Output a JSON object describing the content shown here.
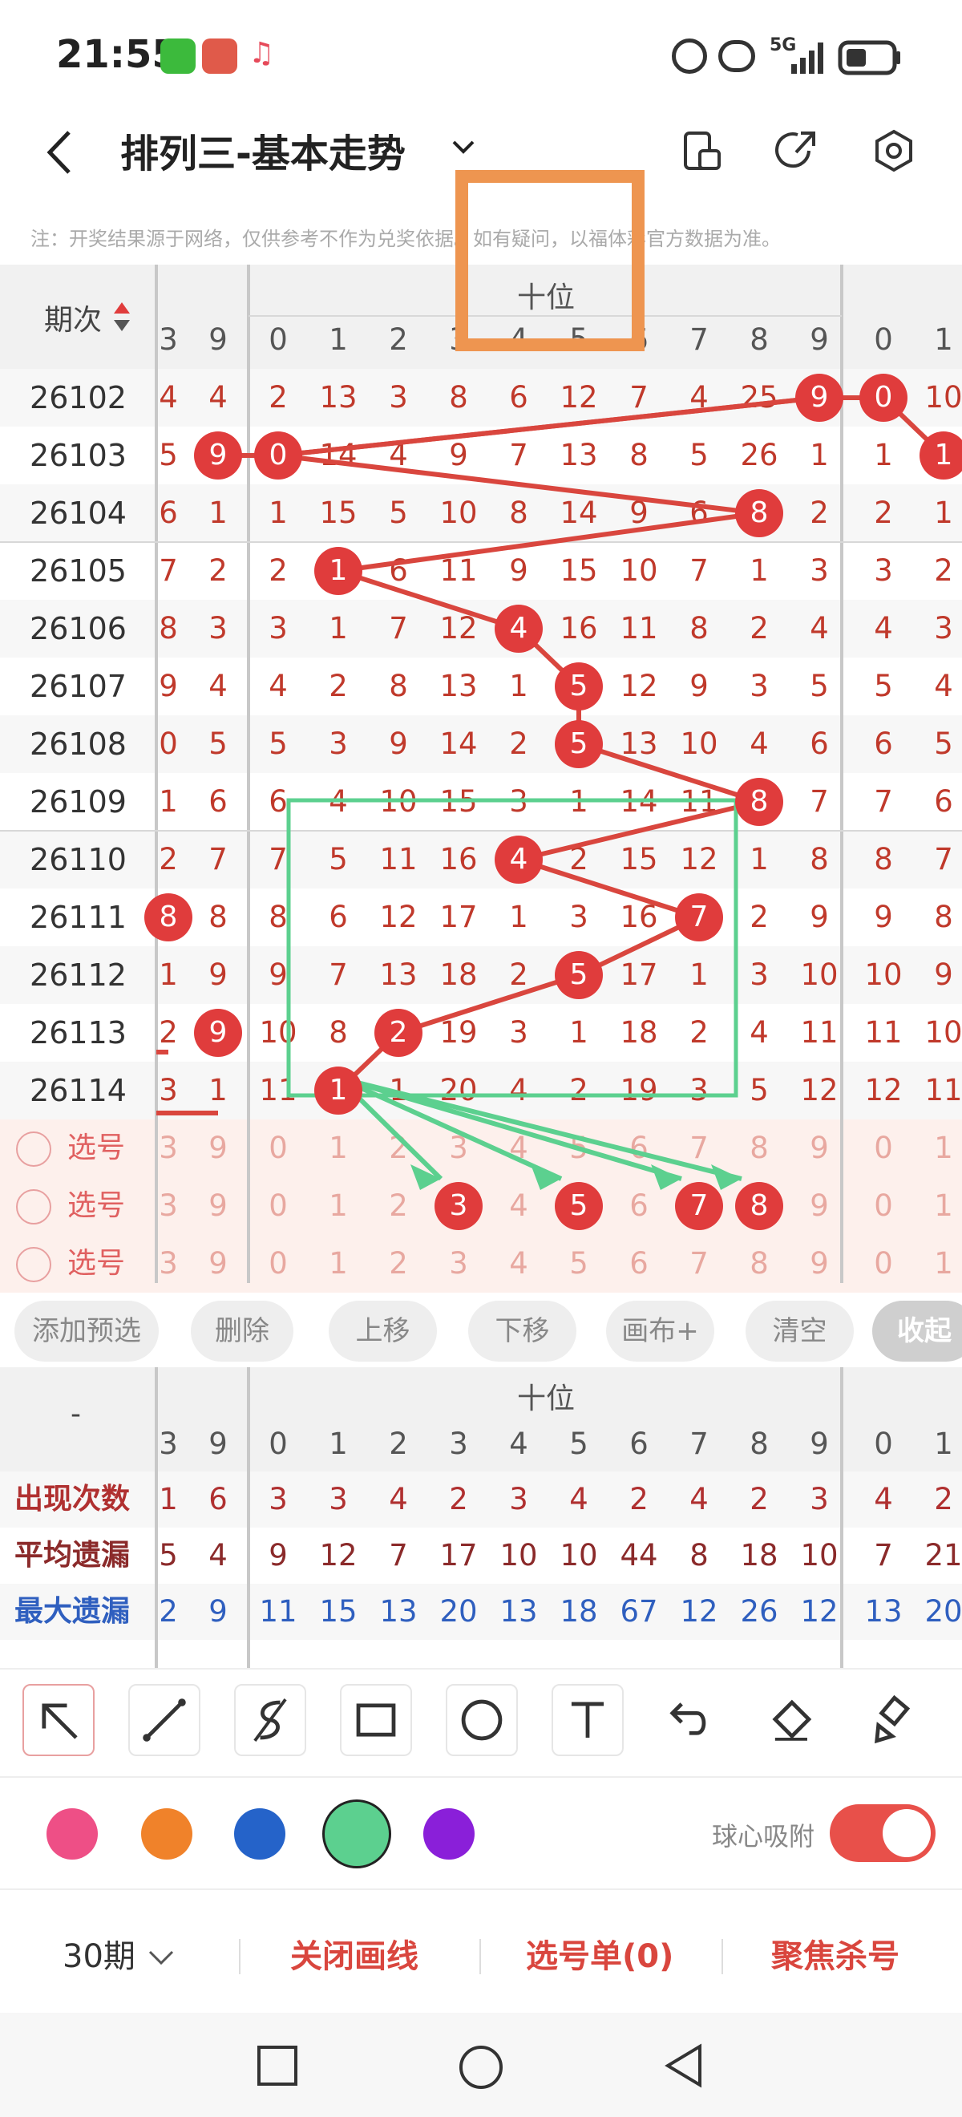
{
  "status": {
    "time": "21:55",
    "signal_label": "5G"
  },
  "header": {
    "title": "排列三-基本走势",
    "note": "注：开奖结果源于网络，仅供参考不作为兑奖依据。如有疑问，以福体彩官方数据为准。"
  },
  "table": {
    "period_header": "期次",
    "group_header": "十位",
    "column_digits": [
      "3",
      "9",
      "0",
      "1",
      "2",
      "3",
      "4",
      "5",
      "6",
      "7",
      "8",
      "9",
      "0",
      "1"
    ],
    "rows": [
      {
        "period": "26102",
        "cells": [
          "4",
          "4",
          "2",
          "13",
          "3",
          "8",
          "6",
          "12",
          "7",
          "4",
          "25",
          "9",
          "0",
          "10"
        ],
        "balls": [
          11,
          12
        ]
      },
      {
        "period": "26103",
        "cells": [
          "5",
          "9",
          "0",
          "14",
          "4",
          "9",
          "7",
          "13",
          "8",
          "5",
          "26",
          "1",
          "1",
          "1"
        ],
        "balls": [
          1,
          2,
          13
        ]
      },
      {
        "period": "26104",
        "cells": [
          "6",
          "1",
          "1",
          "15",
          "5",
          "10",
          "8",
          "14",
          "9",
          "6",
          "8",
          "2",
          "2",
          "1"
        ],
        "balls": [
          10
        ]
      },
      {
        "period": "26105",
        "cells": [
          "7",
          "2",
          "2",
          "1",
          "6",
          "11",
          "9",
          "15",
          "10",
          "7",
          "1",
          "3",
          "3",
          "2"
        ],
        "balls": [
          3
        ]
      },
      {
        "period": "26106",
        "cells": [
          "8",
          "3",
          "3",
          "1",
          "7",
          "12",
          "4",
          "16",
          "11",
          "8",
          "2",
          "4",
          "4",
          "3"
        ],
        "balls": [
          6
        ]
      },
      {
        "period": "26107",
        "cells": [
          "9",
          "4",
          "4",
          "2",
          "8",
          "13",
          "1",
          "5",
          "12",
          "9",
          "3",
          "5",
          "5",
          "4"
        ],
        "balls": [
          7
        ]
      },
      {
        "period": "26108",
        "cells": [
          "0",
          "5",
          "5",
          "3",
          "9",
          "14",
          "2",
          "5",
          "13",
          "10",
          "4",
          "6",
          "6",
          "5"
        ],
        "balls": [
          7
        ]
      },
      {
        "period": "26109",
        "cells": [
          "1",
          "6",
          "6",
          "4",
          "10",
          "15",
          "3",
          "1",
          "14",
          "11",
          "8",
          "7",
          "7",
          "6"
        ],
        "balls": [
          10
        ]
      },
      {
        "period": "26110",
        "cells": [
          "2",
          "7",
          "7",
          "5",
          "11",
          "16",
          "4",
          "2",
          "15",
          "12",
          "1",
          "8",
          "8",
          "7"
        ],
        "balls": [
          6
        ]
      },
      {
        "period": "26111",
        "cells": [
          "8",
          "8",
          "8",
          "6",
          "12",
          "17",
          "1",
          "3",
          "16",
          "7",
          "2",
          "9",
          "9",
          "8"
        ],
        "balls": [
          0,
          9
        ]
      },
      {
        "period": "26112",
        "cells": [
          "1",
          "9",
          "9",
          "7",
          "13",
          "18",
          "2",
          "5",
          "17",
          "1",
          "3",
          "10",
          "10",
          "9"
        ],
        "balls": [
          7
        ]
      },
      {
        "period": "26113",
        "cells": [
          "2",
          "9",
          "10",
          "8",
          "2",
          "19",
          "3",
          "1",
          "18",
          "2",
          "4",
          "11",
          "11",
          "10"
        ],
        "balls": [
          1,
          4
        ]
      },
      {
        "period": "26114",
        "cells": [
          "3",
          "1",
          "11",
          "1",
          "1",
          "20",
          "4",
          "2",
          "19",
          "3",
          "5",
          "12",
          "12",
          "11"
        ],
        "balls": [
          3
        ]
      }
    ],
    "select_label": "选号",
    "select_rows": [
      {
        "cells": [
          "3",
          "9",
          "0",
          "1",
          "2",
          "3",
          "4",
          "5",
          "6",
          "7",
          "8",
          "9",
          "0",
          "1"
        ],
        "balls": []
      },
      {
        "cells": [
          "3",
          "9",
          "0",
          "1",
          "2",
          "3",
          "4",
          "5",
          "6",
          "7",
          "8",
          "9",
          "0",
          "1"
        ],
        "balls": [
          5,
          7,
          9,
          10
        ]
      },
      {
        "cells": [
          "3",
          "9",
          "0",
          "1",
          "2",
          "3",
          "4",
          "5",
          "6",
          "7",
          "8",
          "9",
          "0",
          "1"
        ],
        "balls": []
      }
    ]
  },
  "buttons": [
    "添加预选",
    "删除",
    "上移",
    "下移",
    "画布+",
    "清空",
    "收起"
  ],
  "stats": {
    "corner": "-",
    "group_header": "十位",
    "column_digits": [
      "3",
      "9",
      "0",
      "1",
      "2",
      "3",
      "4",
      "5",
      "6",
      "7",
      "8",
      "9",
      "0",
      "1"
    ],
    "rows": [
      {
        "label": "出现次数",
        "color": "#b03030",
        "values": [
          "1",
          "6",
          "3",
          "3",
          "4",
          "2",
          "3",
          "4",
          "2",
          "4",
          "2",
          "3",
          "4",
          "2"
        ]
      },
      {
        "label": "平均遗漏",
        "color": "#8b2a2a",
        "values": [
          "5",
          "4",
          "9",
          "12",
          "7",
          "17",
          "10",
          "10",
          "44",
          "8",
          "18",
          "10",
          "7",
          "21"
        ]
      },
      {
        "label": "最大遗漏",
        "color": "#2f5fbf",
        "values": [
          "2",
          "9",
          "11",
          "15",
          "13",
          "20",
          "13",
          "18",
          "67",
          "12",
          "26",
          "12",
          "13",
          "20"
        ]
      }
    ]
  },
  "tools": [
    "arrow-select-icon",
    "line-icon",
    "freehand-icon",
    "rectangle-icon",
    "circle-icon",
    "text-icon",
    "undo-icon",
    "eraser-icon",
    "brush-icon"
  ],
  "colors": [
    "#ee4f86",
    "#f0822a",
    "#2563c9",
    "#5cd08f",
    "#8a1fd9"
  ],
  "snap_label": "球心吸附",
  "bottom": {
    "periods": "30期",
    "close_draw": "关闭画线",
    "ticket": "选号单(0)",
    "focus_kill": "聚焦杀号"
  },
  "accent": "#e03c3c"
}
